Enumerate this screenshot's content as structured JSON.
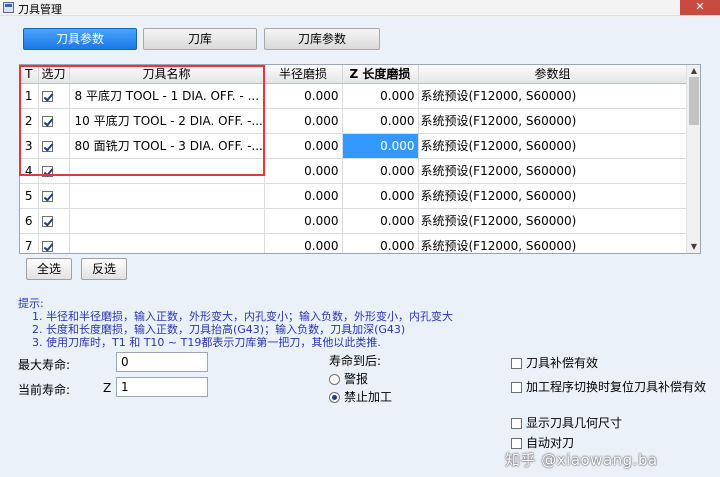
{
  "window": {
    "title": "刀具管理",
    "close_glyph": "✕"
  },
  "tabs": [
    {
      "label": "刀具参数",
      "active": true
    },
    {
      "label": "刀库",
      "active": false
    },
    {
      "label": "刀库参数",
      "active": false
    }
  ],
  "table": {
    "headers": [
      "T",
      "选刀",
      "刀具名称",
      "半径磨损",
      "Z 长度磨损",
      "参数组"
    ],
    "rows": [
      {
        "t": "1",
        "checked": true,
        "name": "8 平底刀   TOOL - 1  DIA. OFF. - ...",
        "radius_wear": "0.000",
        "z_wear": "0.000",
        "param": "系统预设(F12000, S60000)"
      },
      {
        "t": "2",
        "checked": true,
        "name": "10 平底刀   TOOL - 2  DIA. OFF. -...",
        "radius_wear": "0.000",
        "z_wear": "0.000",
        "param": "系统预设(F12000, S60000)"
      },
      {
        "t": "3",
        "checked": true,
        "name": "80 面铣刀   TOOL - 3  DIA. OFF. -...",
        "radius_wear": "0.000",
        "z_wear": "0.000",
        "param": "系统预设(F12000, S60000)"
      },
      {
        "t": "4",
        "checked": true,
        "name": "",
        "radius_wear": "0.000",
        "z_wear": "0.000",
        "param": "系统预设(F12000, S60000)"
      },
      {
        "t": "5",
        "checked": true,
        "name": "",
        "radius_wear": "0.000",
        "z_wear": "0.000",
        "param": "系统预设(F12000, S60000)"
      },
      {
        "t": "6",
        "checked": true,
        "name": "",
        "radius_wear": "0.000",
        "z_wear": "0.000",
        "param": "系统预设(F12000, S60000)"
      },
      {
        "t": "7",
        "checked": true,
        "name": "",
        "radius_wear": "0.000",
        "z_wear": "0.000",
        "param": "系统预设(F12000, S60000)"
      }
    ],
    "selected_cell": "row 3, Z 长度磨损"
  },
  "buttons": {
    "select_all": "全选",
    "invert": "反选"
  },
  "hints": {
    "title": "提示:",
    "lines": [
      "1. 半径和半径磨损，输入正数，外形变大，内孔变小；输入负数，外形变小，内孔变大",
      "2. 长度和长度磨损，输入正数，刀具抬高(G43)；输入负数，刀具加深(G43)",
      "3. 使用刀库时，T1 和 T10 ~ T19都表示刀库第一把刀，其他以此类推."
    ]
  },
  "life": {
    "max_label": "最大寿命:",
    "max_value": "0",
    "current_label": "当前寿命:",
    "z_prefix": "Z",
    "current_value": "1",
    "after_label": "寿命到后:",
    "options": [
      {
        "label": "警报",
        "checked": false
      },
      {
        "label": "禁止加工",
        "checked": true
      }
    ]
  },
  "checkboxes": [
    {
      "label": "刀具补偿有效",
      "checked": false
    },
    {
      "label": "加工程序切换时复位刀具补偿有效",
      "checked": false
    },
    {
      "label": "显示刀具几何尺寸",
      "checked": false
    },
    {
      "label": "自动对刀",
      "checked": false
    }
  ],
  "watermark": "知乎 @xiaowang.ba"
}
